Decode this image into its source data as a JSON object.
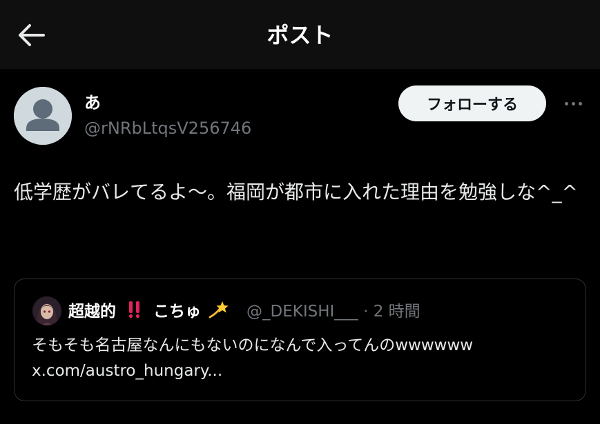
{
  "header": {
    "title": "ポスト",
    "back_icon": "arrow-left-icon"
  },
  "author": {
    "display_name": "あ",
    "handle": "@rNRbLtqsV256746",
    "avatar": "default-avatar-icon"
  },
  "actions": {
    "follow_label": "フォローする",
    "more_icon": "more-horizontal-icon"
  },
  "post": {
    "text": "低学歴がバレてるよ〜。福岡が都市に入れた理由を勉強しな^_^"
  },
  "quote": {
    "display_name": "超越的",
    "name_suffix": "こちゅ",
    "badge_icon": "double-exclamation-emoji",
    "dizzy_icon": "dizzy-emoji",
    "handle": "@_DEKISHI___",
    "separator": "·",
    "time": "2 時間",
    "text_line1": "そもそも名古屋なんにもないのになんで入ってんのwwwwww",
    "text_line2": "x.com/austro_hungary..."
  },
  "colors": {
    "background": "#000000",
    "header_bg": "#0f0f0f",
    "follow_bg": "#eff3f4",
    "muted": "#71767b",
    "border": "#2f3336",
    "badge_red": "#e0245e"
  }
}
